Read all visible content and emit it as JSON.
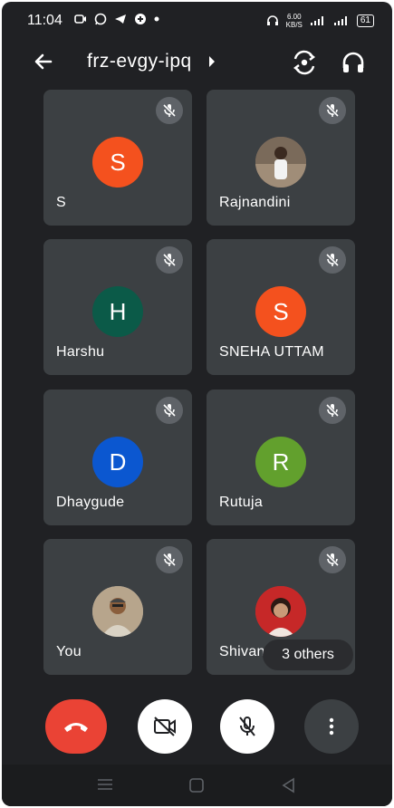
{
  "status_bar": {
    "time": "11:04",
    "speed_value": "6.00",
    "speed_unit": "KB/S",
    "battery": "61"
  },
  "app_bar": {
    "meeting_code": "frz-evgy-ipq"
  },
  "participants": [
    {
      "name": "S",
      "initial": "S",
      "color": "#f4511e",
      "muted": true
    },
    {
      "name": "Rajnandini",
      "initial": "",
      "color": "#8d6e63",
      "photo": true,
      "muted": true
    },
    {
      "name": "Harshu",
      "initial": "H",
      "color": "#0b5a48",
      "muted": true
    },
    {
      "name": "SNEHA UTTAM",
      "initial": "S",
      "color": "#f4511e",
      "muted": true
    },
    {
      "name": "Dhaygude",
      "initial": "D",
      "color": "#0b57d0",
      "muted": true
    },
    {
      "name": "Rutuja",
      "initial": "R",
      "color": "#62a02d",
      "muted": true
    },
    {
      "name": "You",
      "initial": "",
      "color": "#9e9e9e",
      "photo": true,
      "muted": true
    },
    {
      "name": "Shivan",
      "initial": "",
      "color": "#d32f2f",
      "photo": true,
      "muted": true
    }
  ],
  "others_label": "3 others",
  "controls": {
    "end_call": "end-call",
    "camera": "camera-off",
    "mic": "mic-off",
    "more": "more-options"
  },
  "colors": {
    "background": "#202124",
    "tile": "#3c4043",
    "end_call": "#ea4335"
  }
}
